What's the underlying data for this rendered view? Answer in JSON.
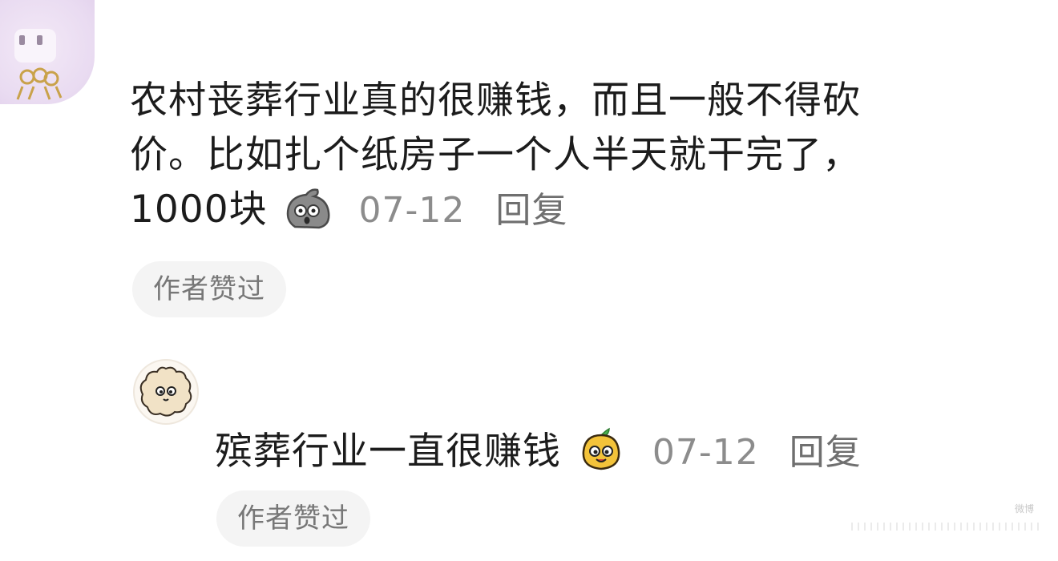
{
  "comments": [
    {
      "avatar_icon": "cartoon-face-avatar-icon",
      "text_line1": "农村丧葬行业真的很赚钱，而且一般不得砍",
      "text_line2": "价。比如扎个纸房子一个人半天就干完了，",
      "text_line3": "1000块",
      "emoji": "shocked-blob-emoji",
      "date": "07-12",
      "reply_label": "回复",
      "liked_label": "作者赞过"
    },
    {
      "avatar_icon": "fluffy-creature-avatar-icon",
      "text": "殡葬行业一直很赚钱",
      "emoji": "smug-pear-emoji",
      "date": "07-12",
      "reply_label": "回复",
      "liked_label": "作者赞过"
    }
  ],
  "watermark": "微博"
}
